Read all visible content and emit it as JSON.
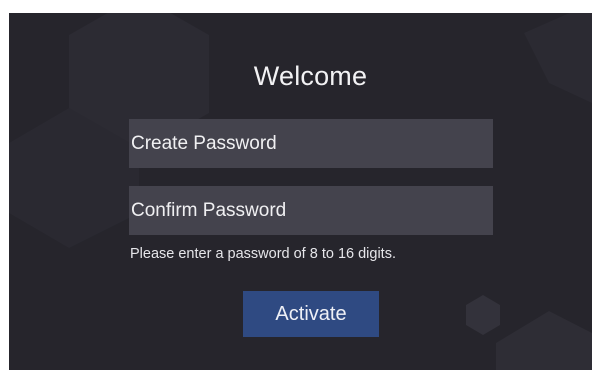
{
  "welcome": {
    "title": "Welcome"
  },
  "form": {
    "create_password_placeholder": "Create Password",
    "create_password_value": "",
    "confirm_password_placeholder": "Confirm Password",
    "confirm_password_value": "",
    "hint": "Please enter a password of 8 to 16 digits.",
    "activate_label": "Activate"
  },
  "colors": {
    "background": "#26252c",
    "field": "#44434d",
    "button": "#2f4a82",
    "text": "#f0f0f2"
  }
}
